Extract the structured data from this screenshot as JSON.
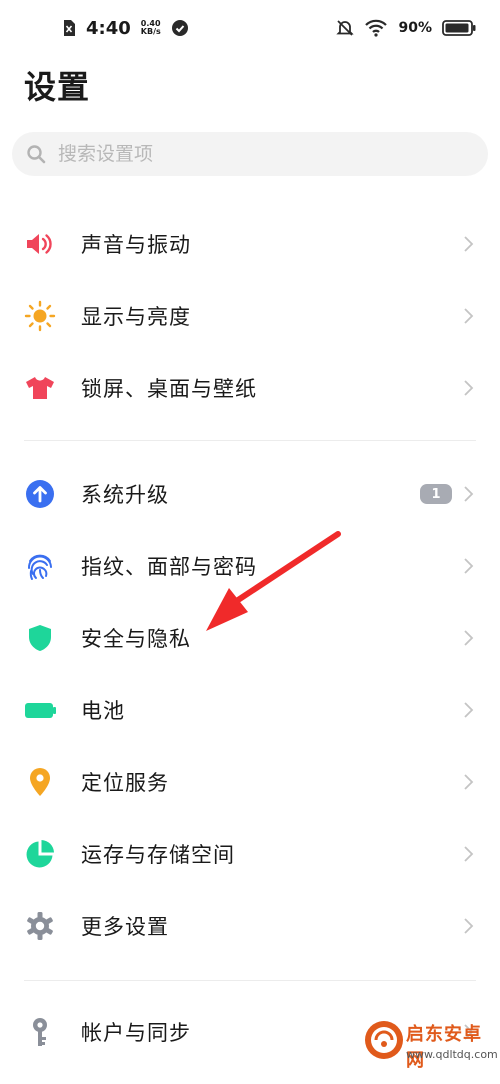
{
  "status_bar": {
    "time": "4:40",
    "net_speed_value": "0.40",
    "net_speed_unit": "KB/s",
    "battery_text": "90%"
  },
  "page": {
    "title": "设置"
  },
  "search": {
    "placeholder": "搜索设置项"
  },
  "settings": {
    "group1": [
      {
        "label": "声音与振动",
        "icon": "speaker-icon",
        "color": "#f0455a"
      },
      {
        "label": "显示与亮度",
        "icon": "sun-icon",
        "color": "#f5a623"
      },
      {
        "label": "锁屏、桌面与壁纸",
        "icon": "shirt-icon",
        "color": "#f0455a"
      }
    ],
    "group2": [
      {
        "label": "系统升级",
        "icon": "upgrade-icon",
        "color": "#3a6ff0",
        "badge": "1"
      },
      {
        "label": "指纹、面部与密码",
        "icon": "fingerprint-icon",
        "color": "#3a6ff0"
      },
      {
        "label": "安全与隐私",
        "icon": "shield-icon",
        "color": "#1ed69a"
      },
      {
        "label": "电池",
        "icon": "battery-icon",
        "color": "#1ed69a"
      },
      {
        "label": "定位服务",
        "icon": "location-pin-icon",
        "color": "#f5a623"
      },
      {
        "label": "运存与存储空间",
        "icon": "pie-chart-icon",
        "color": "#1ed69a"
      },
      {
        "label": "更多设置",
        "icon": "gear-icon",
        "color": "#8a8f99"
      }
    ],
    "group3": [
      {
        "label": "帐户与同步",
        "icon": "key-icon",
        "color": "#8a8f99"
      }
    ]
  },
  "annotation": {
    "arrow_color": "#f02a2a"
  },
  "watermark": {
    "brand": "启东安卓网",
    "url": "www.qdltdq.com"
  }
}
